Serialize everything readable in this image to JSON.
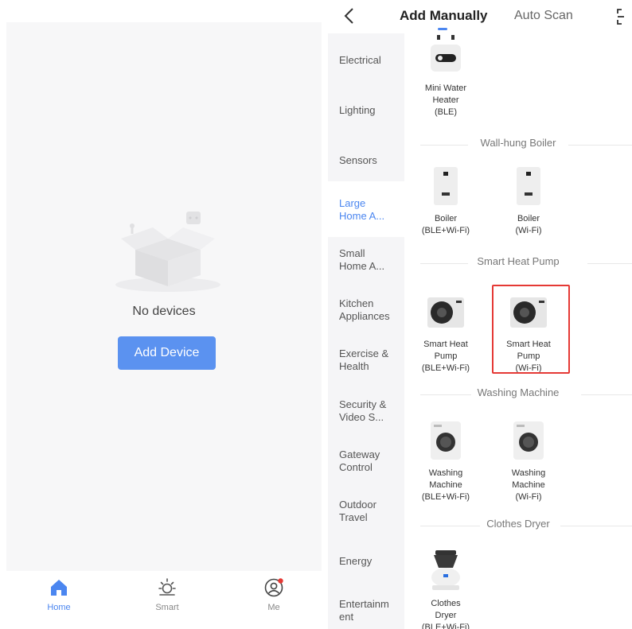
{
  "home": {
    "empty_text": "No devices",
    "add_button": "Add Device",
    "tabs": [
      {
        "label": "Home",
        "icon": "home-icon"
      },
      {
        "label": "Smart",
        "icon": "sun-icon"
      },
      {
        "label": "Me",
        "icon": "profile-icon"
      }
    ]
  },
  "add_device": {
    "tabs": {
      "manual": "Add Manually",
      "auto": "Auto Scan"
    },
    "categories": [
      "Electrical",
      "Lighting",
      "Sensors",
      "Large\nHome A...",
      "Small\nHome A...",
      "Kitchen\nAppliances",
      "Exercise &\nHealth",
      "Security &\nVideo S...",
      "Gateway\nControl",
      "Outdoor\nTravel",
      "Energy",
      "Entertainm\nent"
    ],
    "active_category": 3,
    "sections": [
      {
        "title": "",
        "devices": [
          {
            "name": "Mini Water\nHeater",
            "sub": "(BLE)"
          }
        ]
      },
      {
        "title": "Wall-hung Boiler",
        "devices": [
          {
            "name": "Boiler",
            "sub": "(BLE+Wi-Fi)"
          },
          {
            "name": "Boiler",
            "sub": "(Wi-Fi)"
          }
        ]
      },
      {
        "title": "Smart Heat Pump",
        "devices": [
          {
            "name": "Smart Heat\nPump",
            "sub": "(BLE+Wi-Fi)"
          },
          {
            "name": "Smart Heat\nPump",
            "sub": "(Wi-Fi)"
          }
        ]
      },
      {
        "title": "Washing Machine",
        "devices": [
          {
            "name": "Washing\nMachine",
            "sub": "(BLE+Wi-Fi)"
          },
          {
            "name": "Washing\nMachine",
            "sub": "(Wi-Fi)"
          }
        ]
      },
      {
        "title": "Clothes Dryer",
        "devices": [
          {
            "name": "Clothes\nDryer",
            "sub": "(BLE+Wi-Fi)"
          }
        ]
      }
    ]
  },
  "colors": {
    "accent": "#5b92f0",
    "highlight": "#e53935"
  }
}
